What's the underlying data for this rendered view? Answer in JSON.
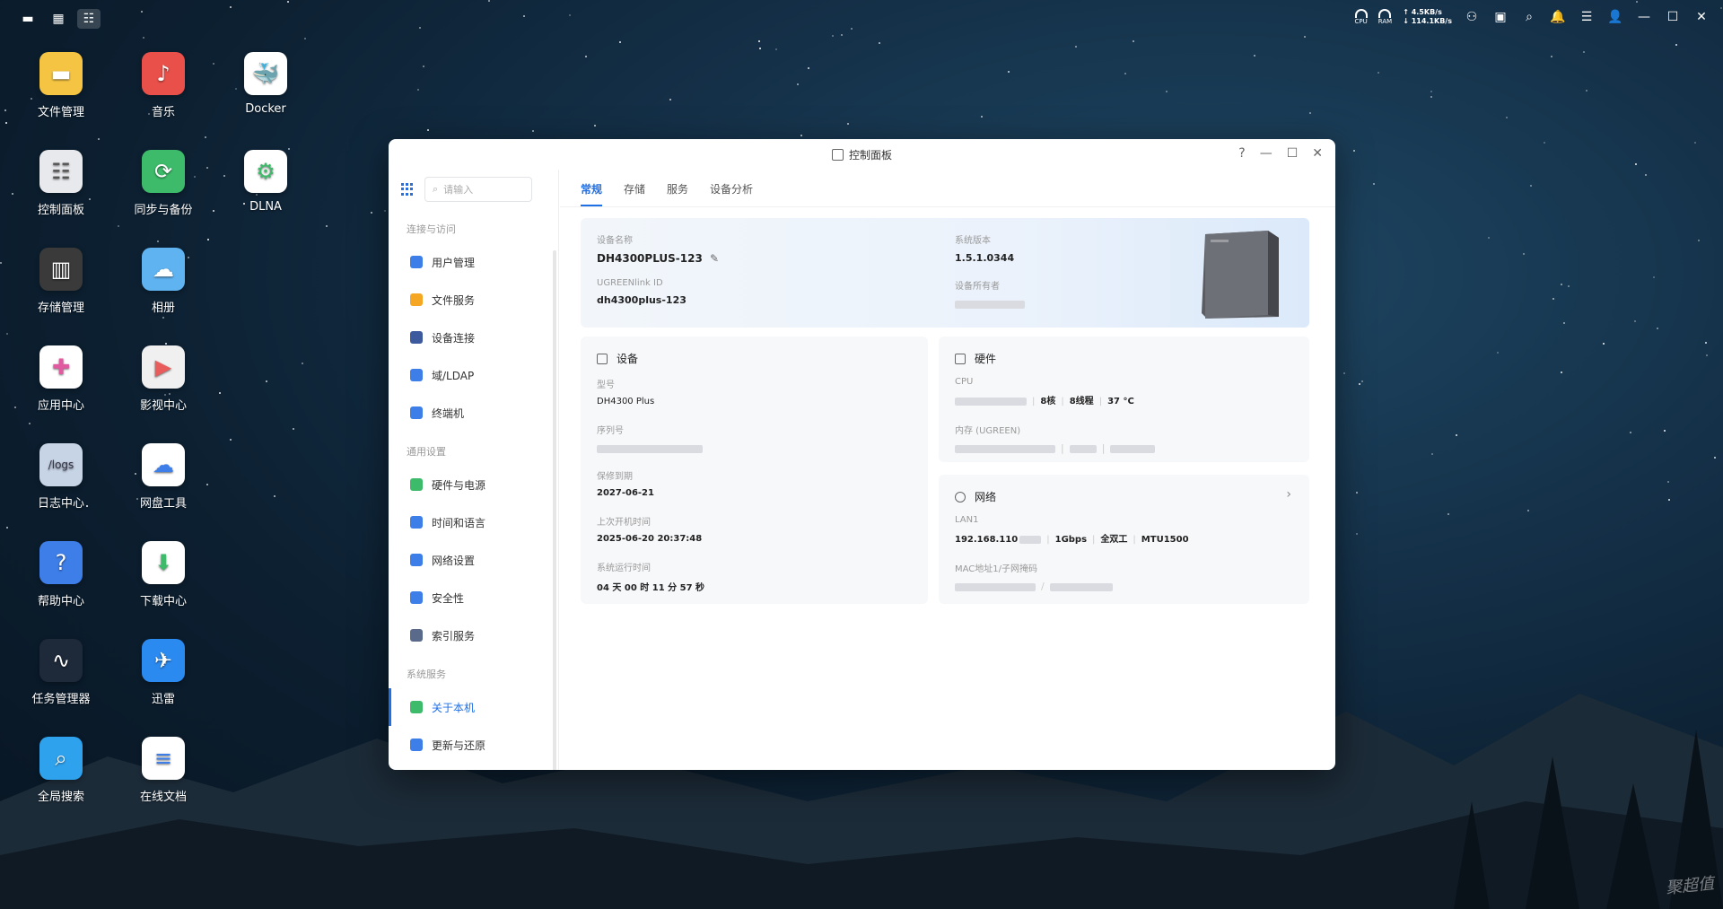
{
  "taskbar": {
    "left_buttons": [
      "show-desktop-icon",
      "app-grid-icon",
      "control-panel-icon"
    ],
    "cpu_label": "CPU",
    "ram_label": "RAM",
    "upload_speed": "4.5KB/s",
    "download_speed": "114.1KB/s"
  },
  "desktop": {
    "icons": [
      {
        "label": "文件管理",
        "icon": "folder-icon",
        "color": "#f5c443"
      },
      {
        "label": "音乐",
        "icon": "music-icon",
        "color": "#e9504a"
      },
      {
        "label": "Docker",
        "icon": "docker-icon",
        "color": "#ffffff"
      },
      {
        "label": "控制面板",
        "icon": "control-panel-icon",
        "color": "#e8e9ec"
      },
      {
        "label": "同步与备份",
        "icon": "sync-icon",
        "color": "#3dbb6a"
      },
      {
        "label": "DLNA",
        "icon": "dlna-icon",
        "color": "#ffffff"
      },
      {
        "label": "存储管理",
        "icon": "storage-icon",
        "color": "#3a3a3a"
      },
      {
        "label": "相册",
        "icon": "photo-icon",
        "color": "#5fb3f0"
      },
      {
        "label": "应用中心",
        "icon": "app-center-icon",
        "color": "#ffffff"
      },
      {
        "label": "影视中心",
        "icon": "video-icon",
        "color": "#f0f0f0"
      },
      {
        "label": "日志中心",
        "icon": "logs-icon",
        "color": "#c7d4e6"
      },
      {
        "label": "网盘工具",
        "icon": "cloud-drive-icon",
        "color": "#ffffff"
      },
      {
        "label": "帮助中心",
        "icon": "help-icon",
        "color": "#3d7ee8"
      },
      {
        "label": "下载中心",
        "icon": "download-icon",
        "color": "#ffffff"
      },
      {
        "label": "任务管理器",
        "icon": "task-manager-icon",
        "color": "#1e2a3a"
      },
      {
        "label": "迅雷",
        "icon": "thunder-icon",
        "color": "#2b8af0"
      },
      {
        "label": "全局搜索",
        "icon": "global-search-icon",
        "color": "#2fa2ee"
      },
      {
        "label": "在线文档",
        "icon": "doc-icon",
        "color": "#ffffff"
      }
    ],
    "logs_text": "/logs"
  },
  "window": {
    "title": "控制面板",
    "search_placeholder": "请输入",
    "sidebar": {
      "groups": [
        {
          "title": "连接与访问",
          "items": [
            "用户管理",
            "文件服务",
            "设备连接",
            "域/LDAP",
            "终端机"
          ]
        },
        {
          "title": "通用设置",
          "items": [
            "硬件与电源",
            "时间和语言",
            "网络设置",
            "安全性",
            "索引服务"
          ]
        },
        {
          "title": "系统服务",
          "items": [
            "关于本机",
            "更新与还原"
          ]
        }
      ],
      "active": "关于本机",
      "icon_colors": [
        "#3d7ee8",
        "#f5a623",
        "#3d5a9e",
        "#3d7ee8",
        "#3d7ee8",
        "#3dbb6a",
        "#3d7ee8",
        "#3d7ee8",
        "#3d7ee8",
        "#5a6a8a",
        "#3dbb6a",
        "#3d7ee8"
      ]
    },
    "tabs": [
      "常规",
      "存储",
      "服务",
      "设备分析"
    ],
    "active_tab": "常规",
    "hero": {
      "device_name_label": "设备名称",
      "device_name": "DH4300PLUS-123",
      "link_id_label": "UGREENlink ID",
      "link_id": "dh4300plus-123",
      "version_label": "系统版本",
      "version": "1.5.1.0344",
      "owner_label": "设备所有者"
    },
    "device_card": {
      "title": "设备",
      "model_label": "型号",
      "model": "DH4300 Plus",
      "serial_label": "序列号",
      "warranty_label": "保修到期",
      "warranty": "2027-06-21",
      "last_boot_label": "上次开机时间",
      "last_boot": "2025-06-20 20:37:48",
      "uptime_label": "系统运行时间",
      "uptime": "04 天 00 时 11 分 57 秒"
    },
    "hardware_card": {
      "title": "硬件",
      "cpu_label": "CPU",
      "cores": "8核",
      "threads": "8线程",
      "temp": "37 °C",
      "memory_label": "内存 (UGREEN)"
    },
    "network_card": {
      "title": "网络",
      "lan_label": "LAN1",
      "ip": "192.168.110",
      "speed": "1Gbps",
      "duplex": "全双工",
      "mtu": "MTU1500",
      "mac_label": "MAC地址1/子网掩码"
    }
  },
  "watermark": "聚超值"
}
